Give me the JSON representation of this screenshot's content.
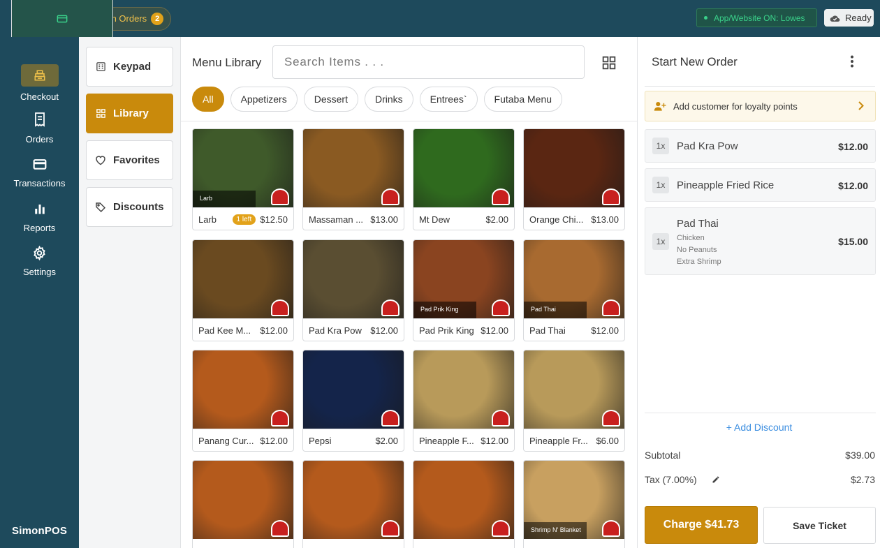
{
  "topbar": {
    "icons": [
      "wifi-icon",
      "printer-icon",
      "card-icon"
    ],
    "open_orders_label": "Open Orders",
    "open_orders_count": "2",
    "app_status": "App/Website ON: Lowes",
    "ready_label": "Ready"
  },
  "nav": {
    "items": [
      {
        "label": "Checkout",
        "icon": "register-icon"
      },
      {
        "label": "Orders",
        "icon": "receipt-icon"
      },
      {
        "label": "Transactions",
        "icon": "card-icon"
      },
      {
        "label": "Reports",
        "icon": "bar-chart-icon"
      },
      {
        "label": "Settings",
        "icon": "gear-icon"
      }
    ],
    "brand": "SimonPOS"
  },
  "categories": {
    "items": [
      {
        "label": "Keypad",
        "icon": "keypad-icon"
      },
      {
        "label": "Library",
        "icon": "grid-icon"
      },
      {
        "label": "Favorites",
        "icon": "heart-icon"
      },
      {
        "label": "Discounts",
        "icon": "tag-icon"
      }
    ]
  },
  "library": {
    "title": "Menu Library",
    "search_placeholder": "Search Items . . .",
    "filters": [
      "All",
      "Appetizers",
      "Dessert",
      "Drinks",
      "Entrees`",
      "Futaba Menu"
    ],
    "items": [
      {
        "name": "Larb",
        "price": "$12.50",
        "stock": "1 left",
        "caption": "Larb",
        "color": "#3f5a2a"
      },
      {
        "name": "Massaman ...",
        "price": "$13.00",
        "color": "#8a5a22"
      },
      {
        "name": "Mt Dew",
        "price": "$2.00",
        "color": "#2f6a1e"
      },
      {
        "name": "Orange Chi...",
        "price": "$13.00",
        "color": "#5a2612"
      },
      {
        "name": "Pad Kee M...",
        "price": "$12.00",
        "color": "#6a4a20"
      },
      {
        "name": "Pad Kra Pow",
        "price": "$12.00",
        "color": "#5a4e32"
      },
      {
        "name": "Pad Prik King",
        "price": "$12.00",
        "caption": "Pad Prik King",
        "color": "#8a4420"
      },
      {
        "name": "Pad Thai",
        "price": "$12.00",
        "caption": "Pad Thai",
        "color": "#a86a30"
      },
      {
        "name": "Panang Cur...",
        "price": "$12.00",
        "color": "#b45a1c"
      },
      {
        "name": "Pepsi",
        "price": "$2.00",
        "color": "#14244a"
      },
      {
        "name": "Pineapple F...",
        "price": "$12.00",
        "color": "#b89a5a"
      },
      {
        "name": "Pineapple Fr...",
        "price": "$6.00",
        "color": "#b89a5a"
      },
      {
        "name": "",
        "price": "",
        "color": "#b45a1c"
      },
      {
        "name": "",
        "price": "",
        "color": "#b45a1c"
      },
      {
        "name": "",
        "price": "",
        "color": "#b45a1c"
      },
      {
        "name": "",
        "price": "",
        "caption": "Shrimp N' Blanket",
        "color": "#c8a060"
      }
    ]
  },
  "order": {
    "title": "Start New Order",
    "loyalty_label": "Add customer for loyalty points",
    "lines": [
      {
        "qty": "1x",
        "name": "Pad Kra Pow",
        "price": "$12.00",
        "mods": []
      },
      {
        "qty": "1x",
        "name": "Pineapple Fried Rice",
        "price": "$12.00",
        "mods": []
      },
      {
        "qty": "1x",
        "name": "Pad Thai",
        "price": "$15.00",
        "mods": [
          "Chicken",
          "No Peanuts",
          "Extra Shrimp"
        ]
      }
    ],
    "add_discount": "+ Add Discount",
    "subtotal_label": "Subtotal",
    "subtotal": "$39.00",
    "tax_label": "Tax (7.00%)",
    "tax": "$2.73",
    "charge_label": "Charge $41.73",
    "save_label": "Save Ticket"
  },
  "colors": {
    "sidebar": "#1e4a5c",
    "accent": "#c98a0c",
    "link": "#3c8ee0"
  }
}
